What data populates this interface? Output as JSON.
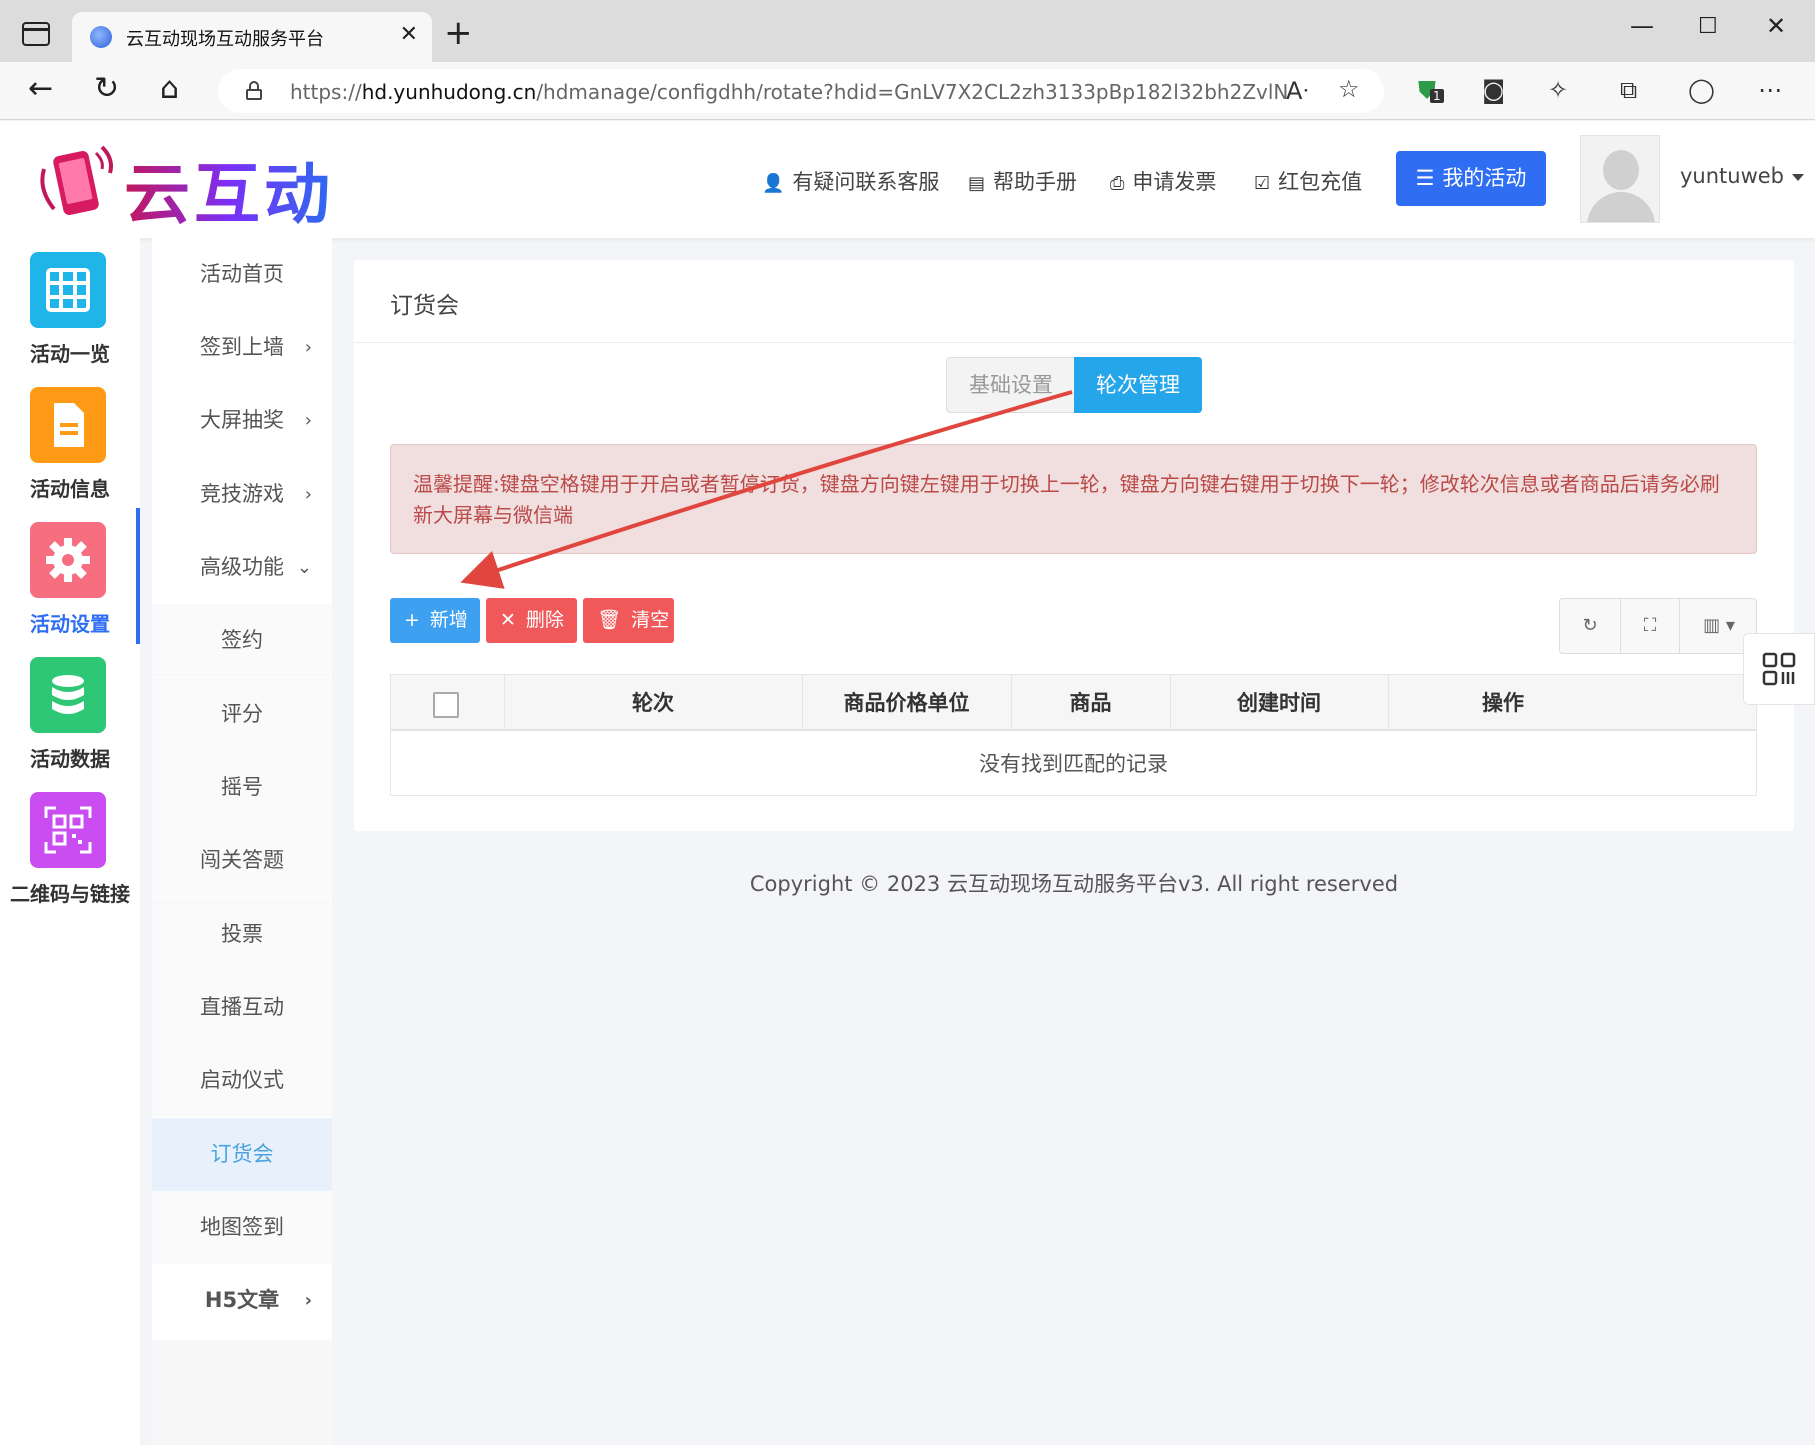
{
  "browser": {
    "tab_title": "云互动现场互动服务平台",
    "url_prefix": "https://",
    "url_domain": "hd.yunhudong.cn",
    "url_path": "/hdmanage/configdhh/rotate?hdid=GnLV7X2CL2zh3133pBp182l32bh2ZvlN",
    "extension_badge": "1"
  },
  "header": {
    "logo_text": "云互动",
    "links": [
      "有疑问联系客服",
      "帮助手册",
      "申请发票",
      "红包充值"
    ],
    "my_activity_label": "我的活动",
    "username": "yuntuweb",
    "accent_color": "#2f6ef3"
  },
  "icon_nav": [
    {
      "label": "活动一览",
      "icon": "grid-icon",
      "color": "#1fb5e8"
    },
    {
      "label": "活动信息",
      "icon": "document-icon",
      "color": "#ff9a16"
    },
    {
      "label": "活动设置",
      "icon": "gear-icon",
      "color": "#f76e80"
    },
    {
      "label": "活动数据",
      "icon": "database-icon",
      "color": "#2ec775"
    },
    {
      "label": "二维码与链接",
      "icon": "qrcode-icon",
      "color": "#c94df0"
    }
  ],
  "sub_menu": {
    "items": [
      "活动首页",
      "签到上墙",
      "大屏抽奖",
      "竞技游戏",
      "高级功能",
      "签约",
      "评分",
      "摇号",
      "闯关答题",
      "投票",
      "直播互动",
      "启动仪式",
      "订货会",
      "地图签到",
      "H5文章"
    ],
    "active": "订货会"
  },
  "panel": {
    "title": "订货会",
    "tabs": [
      "基础设置",
      "轮次管理"
    ],
    "active_tab": "轮次管理",
    "alert_text": "温馨提醒:键盘空格键用于开启或者暂停订货，键盘方向键左键用于切换上一轮，键盘方向键右键用于切换下一轮；修改轮次信息或者商品后请务必刷新大屏幕与微信端",
    "buttons": {
      "add": "新增",
      "delete": "删除",
      "clear": "清空"
    },
    "table": {
      "columns": [
        "轮次",
        "商品价格单位",
        "商品",
        "创建时间",
        "操作"
      ],
      "empty_text": "没有找到匹配的记录"
    }
  },
  "footer": {
    "copyright": "Copyright © 2023 云互动现场互动服务平台v3. All right reserved"
  }
}
